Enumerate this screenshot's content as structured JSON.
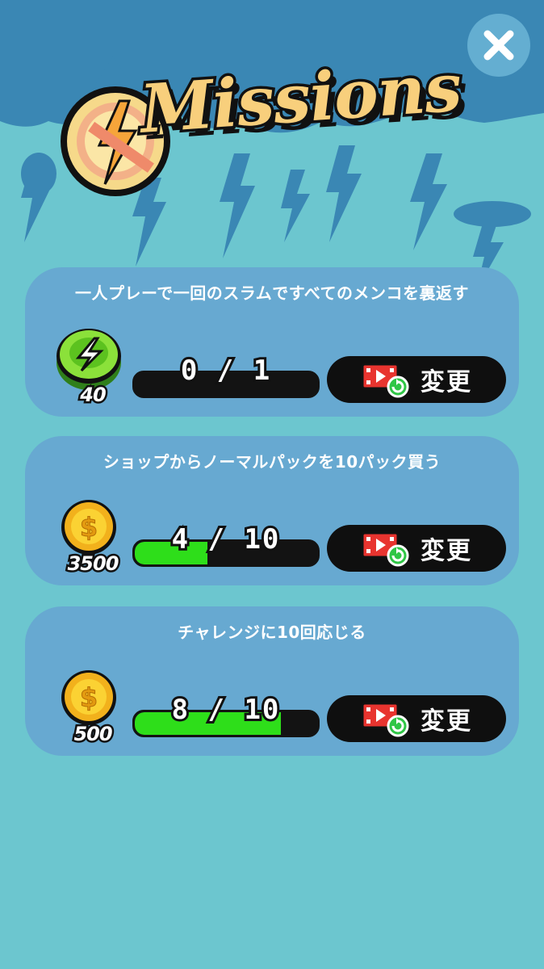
{
  "title": "Missions",
  "close_icon": "close-x-icon",
  "colors": {
    "background": "#6cc6cf",
    "cloud": "#3a87b4",
    "card": "#67a9d1",
    "progress_fill": "#2ede1a",
    "button": "#0f0f0f",
    "title_text": "#f8cf7c"
  },
  "missions": [
    {
      "title": "一人プレーで一回のスラムですべてのメンコを裏返す",
      "reward_icon": "green-menko-bolt-icon",
      "reward_amount": "40",
      "progress_text": "0 / 1",
      "progress": 0,
      "button_label": "変更",
      "button_icon": "video-ad-refresh-icon"
    },
    {
      "title": "ショップからノーマルパックを10パック買う",
      "reward_icon": "gold-coin-dollar-icon",
      "reward_amount": "3500",
      "progress_text": "4 / 10",
      "progress": 0.4,
      "button_label": "変更",
      "button_icon": "video-ad-refresh-icon"
    },
    {
      "title": "チャレンジに10回応じる",
      "reward_icon": "gold-coin-dollar-icon",
      "reward_amount": "500",
      "progress_text": "8 / 10",
      "progress": 0.8,
      "button_label": "変更",
      "button_icon": "video-ad-refresh-icon"
    }
  ]
}
